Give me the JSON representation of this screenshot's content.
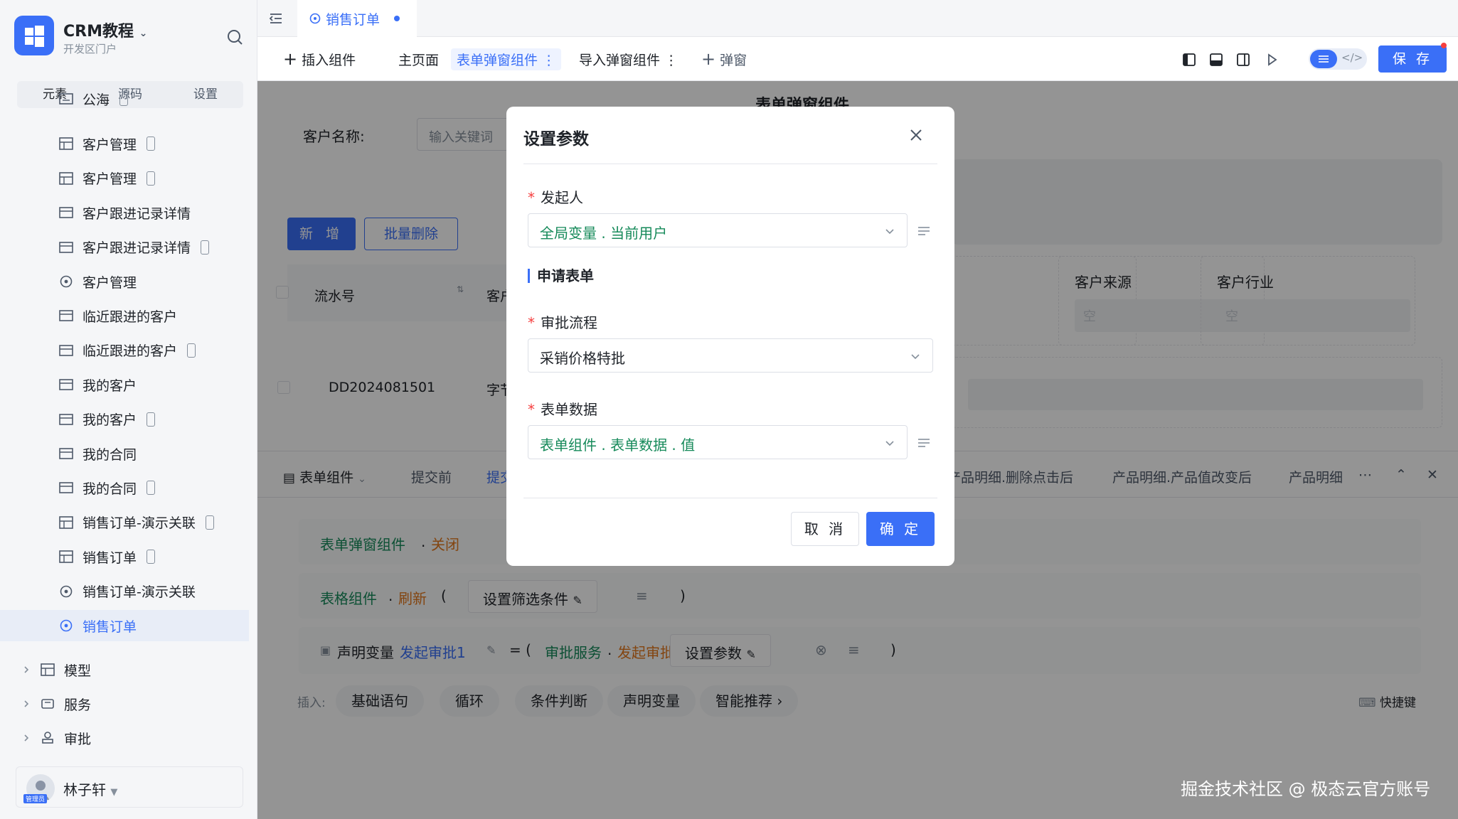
{
  "app": {
    "title": "CRM教程",
    "subtitle": "开发区门户"
  },
  "sidebar": {
    "tabs": [
      "元素",
      "源码",
      "设置"
    ],
    "items": [
      {
        "label": "公海",
        "icon": "form-icon",
        "mobile": true
      },
      {
        "label": "客户管理",
        "icon": "table-icon",
        "mobile": true
      },
      {
        "label": "客户管理",
        "icon": "table-icon",
        "mobile": true
      },
      {
        "label": "客户跟进记录详情",
        "icon": "detail-icon",
        "mobile": false
      },
      {
        "label": "客户跟进记录详情",
        "icon": "detail-icon",
        "mobile": true
      },
      {
        "label": "客户管理",
        "icon": "process-icon",
        "mobile": false
      },
      {
        "label": "临近跟进的客户",
        "icon": "detail-icon",
        "mobile": false
      },
      {
        "label": "临近跟进的客户",
        "icon": "detail-icon",
        "mobile": true
      },
      {
        "label": "我的客户",
        "icon": "detail-icon",
        "mobile": false
      },
      {
        "label": "我的客户",
        "icon": "detail-icon",
        "mobile": true
      },
      {
        "label": "我的合同",
        "icon": "detail-icon",
        "mobile": false
      },
      {
        "label": "我的合同",
        "icon": "detail-icon",
        "mobile": true
      },
      {
        "label": "销售订单-演示关联",
        "icon": "table-icon",
        "mobile": true
      },
      {
        "label": "销售订单",
        "icon": "table-icon",
        "mobile": true
      },
      {
        "label": "销售订单-演示关联",
        "icon": "process-icon",
        "mobile": false
      },
      {
        "label": "销售订单",
        "icon": "process-icon",
        "mobile": false,
        "active": true
      }
    ],
    "groups": [
      "模型",
      "服务",
      "审批"
    ],
    "user": {
      "name": "林子轩",
      "role": "管理员"
    }
  },
  "topbar": {
    "page_tab": "销售订单"
  },
  "toolbar": {
    "insert_component": "插入组件",
    "main_page": "主页面",
    "form_popup_component": "表单弹窗组件",
    "import_popup_component": "导入弹窗组件",
    "popup": "弹窗",
    "save": "保 存"
  },
  "canvas": {
    "customer_name_label": "客户名称:",
    "customer_name_placeholder": "输入关键词",
    "add_button": "新 增",
    "batch_delete_button": "批量删除",
    "table_headers": [
      "流水号",
      "客户"
    ],
    "table_rows": [
      [
        "DD2024081501",
        "字节"
      ]
    ],
    "right_title": "表单弹窗组件",
    "fields": [
      {
        "label": "客户来源",
        "value": "空"
      },
      {
        "label": "客户行业",
        "value": "空"
      }
    ]
  },
  "bottom_tabs": {
    "component": "表单组件",
    "tabs": [
      "提交前",
      "提交后",
      "产品明细.删除点击后",
      "产品明细.产品值改变后",
      "产品明细"
    ]
  },
  "code": {
    "row1": {
      "obj": "表单弹窗组件",
      "dot": ".",
      "method": "关闭"
    },
    "row2": {
      "obj": "表格组件",
      "dot": ".",
      "method": "刷新",
      "open": "(",
      "param": "设置筛选条件",
      "close": ")"
    },
    "row3": {
      "declare": "声明变量",
      "var": "发起审批1",
      "assign": "= (",
      "service": "审批服务",
      "dot": ".",
      "method": "发起审批",
      "param": "设置参数",
      "close": ")"
    },
    "insert_label": "插入:",
    "insert_chips": [
      "基础语句",
      "循环",
      "条件判断",
      "声明变量",
      "智能推荐"
    ],
    "shortcut": "快捷键"
  },
  "modal": {
    "title": "设置参数",
    "initiator_label": "发起人",
    "initiator_value": "全局变量 . 当前用户",
    "section_title": "申请表单",
    "process_label": "审批流程",
    "process_value": "采销价格特批",
    "form_data_label": "表单数据",
    "form_data_value": "表单组件 . 表单数据 . 值",
    "cancel": "取 消",
    "ok": "确 定"
  },
  "watermark": "掘金技术社区 @ 极态云官方账号",
  "colors": {
    "primary": "#3a6ff7",
    "required": "#f53f3f",
    "keyword_green": "#168a5a",
    "keyword_orange": "#e2781d"
  }
}
